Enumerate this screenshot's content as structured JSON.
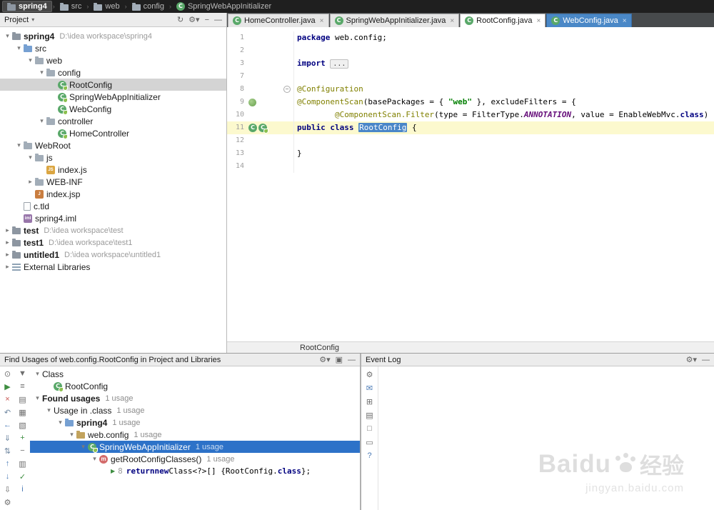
{
  "colors": {
    "selection_blue": "#2D72C8",
    "current_line_highlight": "#FCF9CE",
    "identifier_highlight": "#4A86C8",
    "keyword": "#000080",
    "string": "#008000",
    "annotation": "#808000",
    "constant": "#660E7A",
    "highlight_tab": "#4A88C7"
  },
  "nav_bar": {
    "items": [
      {
        "label": "spring4",
        "icon": "project",
        "active": true
      },
      {
        "label": "src",
        "icon": "folder",
        "active": false
      },
      {
        "label": "web",
        "icon": "folder",
        "active": false
      },
      {
        "label": "config",
        "icon": "folder",
        "active": false
      },
      {
        "label": "SpringWebAppInitializer",
        "icon": "class",
        "active": false
      }
    ]
  },
  "project_panel": {
    "title": "Project",
    "header_icons": [
      {
        "name": "sync-icon",
        "glyph": "↻"
      },
      {
        "name": "settings-icon",
        "glyph": "⚙▾"
      },
      {
        "name": "collapse-all-icon",
        "glyph": "−"
      },
      {
        "name": "hide-icon",
        "glyph": "—"
      }
    ],
    "tree": [
      {
        "label": "spring4",
        "hint": "D:\\idea workspace\\spring4",
        "depth": 0,
        "chev": "open",
        "icon": "project",
        "bold": true
      },
      {
        "label": "src",
        "depth": 1,
        "chev": "open",
        "icon": "folder-src"
      },
      {
        "label": "web",
        "depth": 2,
        "chev": "open",
        "icon": "folder"
      },
      {
        "label": "config",
        "depth": 3,
        "chev": "open",
        "icon": "folder"
      },
      {
        "label": "RootConfig",
        "depth": 4,
        "icon": "class-spring",
        "selected": true
      },
      {
        "label": "SpringWebAppInitializer",
        "depth": 4,
        "icon": "class-spring"
      },
      {
        "label": "WebConfig",
        "depth": 4,
        "icon": "class-spring"
      },
      {
        "label": "controller",
        "depth": 3,
        "chev": "open",
        "icon": "folder"
      },
      {
        "label": "HomeController",
        "depth": 4,
        "icon": "class-spring"
      },
      {
        "label": "WebRoot",
        "depth": 1,
        "chev": "open",
        "icon": "folder"
      },
      {
        "label": "js",
        "depth": 2,
        "chev": "open",
        "icon": "folder"
      },
      {
        "label": "index.js",
        "depth": 3,
        "icon": "file-js"
      },
      {
        "label": "WEB-INF",
        "depth": 2,
        "chev": "closed",
        "icon": "folder"
      },
      {
        "label": "index.jsp",
        "depth": 2,
        "icon": "file-jsp"
      },
      {
        "label": "c.tld",
        "depth": 1,
        "icon": "file"
      },
      {
        "label": "spring4.iml",
        "depth": 1,
        "icon": "file-iml"
      },
      {
        "label": "test",
        "hint": "D:\\idea workspace\\test",
        "depth": 0,
        "chev": "closed",
        "icon": "project",
        "bold": true
      },
      {
        "label": "test1",
        "hint": "D:\\idea workspace\\test1",
        "depth": 0,
        "chev": "closed",
        "icon": "project",
        "bold": true
      },
      {
        "label": "untitled1",
        "hint": "D:\\idea workspace\\untitled1",
        "depth": 0,
        "chev": "closed",
        "icon": "project",
        "bold": true
      },
      {
        "label": "External Libraries",
        "depth": 0,
        "chev": "closed",
        "icon": "libs"
      }
    ]
  },
  "editor": {
    "tabs": [
      {
        "label": "HomeController.java",
        "state": "normal"
      },
      {
        "label": "SpringWebAppInitializer.java",
        "state": "normal"
      },
      {
        "label": "RootConfig.java",
        "state": "active"
      },
      {
        "label": "WebConfig.java",
        "state": "highlight"
      }
    ],
    "breadcrumb": "RootConfig",
    "code_lines": [
      {
        "num": "1",
        "segs": [
          [
            "kw",
            "package"
          ],
          [
            "pl",
            " web.config;"
          ]
        ]
      },
      {
        "num": "2",
        "segs": []
      },
      {
        "num": "3",
        "segs": [
          [
            "kw",
            "import "
          ],
          [
            "fold",
            "..."
          ]
        ]
      },
      {
        "num": "7",
        "segs": []
      },
      {
        "num": "8",
        "segs": [
          [
            "ann",
            "@Configuration"
          ]
        ],
        "fold": true
      },
      {
        "num": "9",
        "segs": [
          [
            "ann",
            "@ComponentScan"
          ],
          [
            "pl",
            "(basePackages = { "
          ],
          [
            "str",
            "\"web\""
          ],
          [
            "pl",
            " }, excludeFilters = {"
          ]
        ],
        "gutter": [
          "spring-bean"
        ]
      },
      {
        "num": "10",
        "segs": [
          [
            "pl",
            "        "
          ],
          [
            "ann",
            "@ComponentScan.Filter"
          ],
          [
            "pl",
            "(type = FilterType."
          ],
          [
            "const",
            "ANNOTATION"
          ],
          [
            "pl",
            ", value = EnableWebMvc."
          ],
          [
            "kw",
            "class"
          ],
          [
            "pl",
            ") })"
          ]
        ]
      },
      {
        "num": "11",
        "segs": [
          [
            "kw",
            "public class "
          ],
          [
            "sel",
            "RootConfig"
          ],
          [
            "pl",
            " {"
          ]
        ],
        "highlight": true,
        "gutter": [
          "class",
          "class-spring"
        ]
      },
      {
        "num": "12",
        "segs": []
      },
      {
        "num": "13",
        "segs": [
          [
            "pl",
            "}"
          ]
        ]
      },
      {
        "num": "14",
        "segs": []
      }
    ]
  },
  "find_usages": {
    "title": "Find Usages of web.config.RootConfig in Project and Libraries",
    "header_icons": [
      {
        "name": "settings-icon",
        "glyph": "⚙▾"
      },
      {
        "name": "float-icon",
        "glyph": "▣"
      },
      {
        "name": "hide-icon",
        "glyph": "—"
      }
    ],
    "toolbar_left": [
      {
        "name": "pin-icon",
        "glyph": "⊙",
        "color": "#6e6e6e"
      },
      {
        "name": "rerun-icon",
        "glyph": "▶",
        "color": "#3e8e41"
      },
      {
        "name": "close-icon",
        "glyph": "×",
        "color": "#c75450"
      },
      {
        "name": "restore-icon",
        "glyph": "↶",
        "color": "#6e86a0"
      },
      {
        "name": "back-icon",
        "glyph": "←",
        "color": "#4a7ab5"
      },
      {
        "name": "scroll-from-source-icon",
        "glyph": "⇓",
        "color": "#6e86a0"
      },
      {
        "name": "autoscroll-icon",
        "glyph": "⇅",
        "color": "#6e86a0"
      },
      {
        "name": "previous-usage-icon",
        "glyph": "↑",
        "color": "#4a7ab5"
      },
      {
        "name": "next-usage-icon",
        "glyph": "↓",
        "color": "#4a7ab5"
      },
      {
        "name": "export-icon",
        "glyph": "⇩",
        "color": "#6e6e6e"
      },
      {
        "name": "settings-small-icon",
        "glyph": "⚙",
        "color": "#6e6e6e"
      }
    ],
    "toolbar_right": [
      {
        "name": "filter-icon",
        "glyph": "▼",
        "color": "#6e6e6e"
      },
      {
        "name": "group-by-usage-type-icon",
        "glyph": "≡",
        "color": "#6e6e6e"
      },
      {
        "name": "group-by-module-icon",
        "glyph": "▤",
        "color": "#6e6e6e"
      },
      {
        "name": "group-by-package-icon",
        "glyph": "▦",
        "color": "#6e6e6e"
      },
      {
        "name": "flatten-packages-icon",
        "glyph": "▧",
        "color": "#6e6e6e"
      },
      {
        "name": "expand-all-icon",
        "glyph": "+",
        "color": "#3e8e41"
      },
      {
        "name": "collapse-all-icon",
        "glyph": "−",
        "color": "#6e6e6e"
      },
      {
        "name": "preview-usages-icon",
        "glyph": "▥",
        "color": "#6e6e6e"
      },
      {
        "name": "select-in-icon",
        "glyph": "✓",
        "color": "#3e8e41"
      },
      {
        "name": "info-icon",
        "glyph": "i",
        "color": "#4a7ab5"
      }
    ],
    "tree": [
      {
        "label": "Class",
        "depth": 0,
        "chev": "open"
      },
      {
        "label": "RootConfig",
        "depth": 1,
        "icon": "class-spring"
      },
      {
        "label": "Found usages",
        "badge": "1 usage",
        "depth": 0,
        "chev": "open",
        "bold": true
      },
      {
        "label": "Usage in .class",
        "badge": "1 usage",
        "depth": 1,
        "chev": "open"
      },
      {
        "label": "spring4",
        "badge": "1 usage",
        "depth": 2,
        "chev": "open",
        "icon": "folder-blue",
        "bold": true
      },
      {
        "label": "web.config",
        "badge": "1 usage",
        "depth": 3,
        "chev": "open",
        "icon": "package"
      },
      {
        "label": "SpringWebAppInitializer",
        "badge": "1 usage",
        "depth": 4,
        "chev": "open",
        "icon": "class-spring",
        "selected": true
      },
      {
        "label": "getRootConfigClasses()",
        "badge": "1 usage",
        "depth": 5,
        "chev": "open",
        "icon": "method"
      },
      {
        "depth": 6,
        "icon": "usage",
        "line_number": "8",
        "code": [
          [
            "kw",
            "return "
          ],
          [
            "kw",
            "new "
          ],
          [
            "pl",
            "Class<?>[] { "
          ],
          [
            "pl",
            "RootConfig."
          ],
          [
            "kw",
            "class"
          ],
          [
            "pl",
            " };"
          ]
        ]
      }
    ]
  },
  "event_log": {
    "title": "Event Log",
    "header_icons": [
      {
        "name": "settings-icon",
        "glyph": "⚙▾"
      },
      {
        "name": "hide-icon",
        "glyph": "—"
      }
    ],
    "toolbar": [
      {
        "name": "settings-icon",
        "glyph": "⚙",
        "color": "#6e6e6e"
      },
      {
        "name": "message-icon",
        "glyph": "✉",
        "color": "#4a7ab5"
      },
      {
        "name": "expand-icon",
        "glyph": "⊞",
        "color": "#6e6e6e"
      },
      {
        "name": "clear-all-icon",
        "glyph": "▤",
        "color": "#6e6e6e"
      },
      {
        "name": "mark-all-read-icon",
        "glyph": "□",
        "color": "#6e6e6e"
      },
      {
        "name": "soft-wrap-icon",
        "glyph": "▭",
        "color": "#6e6e6e"
      },
      {
        "name": "help-icon",
        "glyph": "?",
        "color": "#4a7ab5"
      }
    ],
    "watermark": {
      "brand": "Baidu",
      "suffix": "经验",
      "url": "jingyan.baidu.com"
    }
  }
}
